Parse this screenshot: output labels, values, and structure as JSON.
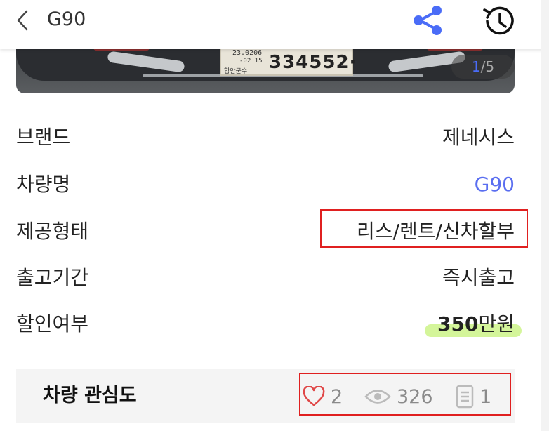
{
  "header": {
    "title": "G90",
    "icons": [
      "back-icon",
      "share-icon",
      "history-icon"
    ],
    "accent_color": "#4a6cf7"
  },
  "photo": {
    "plate_line1": "23.0206",
    "plate_line2": "-02 15",
    "plate_line3": "합안군수",
    "plate_number": "334552·",
    "counter_current": "1",
    "counter_separator": "/",
    "counter_total": "5"
  },
  "details": {
    "brand": {
      "label": "브랜드",
      "value": "제네시스"
    },
    "model": {
      "label": "차량명",
      "value": "G90"
    },
    "offer_type": {
      "label": "제공형태",
      "value": "리스/렌트/신차할부"
    },
    "delivery": {
      "label": "출고기간",
      "value": "즉시출고"
    },
    "discount": {
      "label": "할인여부",
      "amount": "350",
      "unit": "만원"
    }
  },
  "interest": {
    "title": "차량 관심도",
    "likes": "2",
    "views": "326",
    "comments": "1"
  },
  "colors": {
    "link": "#5a6ef0",
    "highlight": "#d4f59a",
    "annotation_box": "#e02020"
  }
}
